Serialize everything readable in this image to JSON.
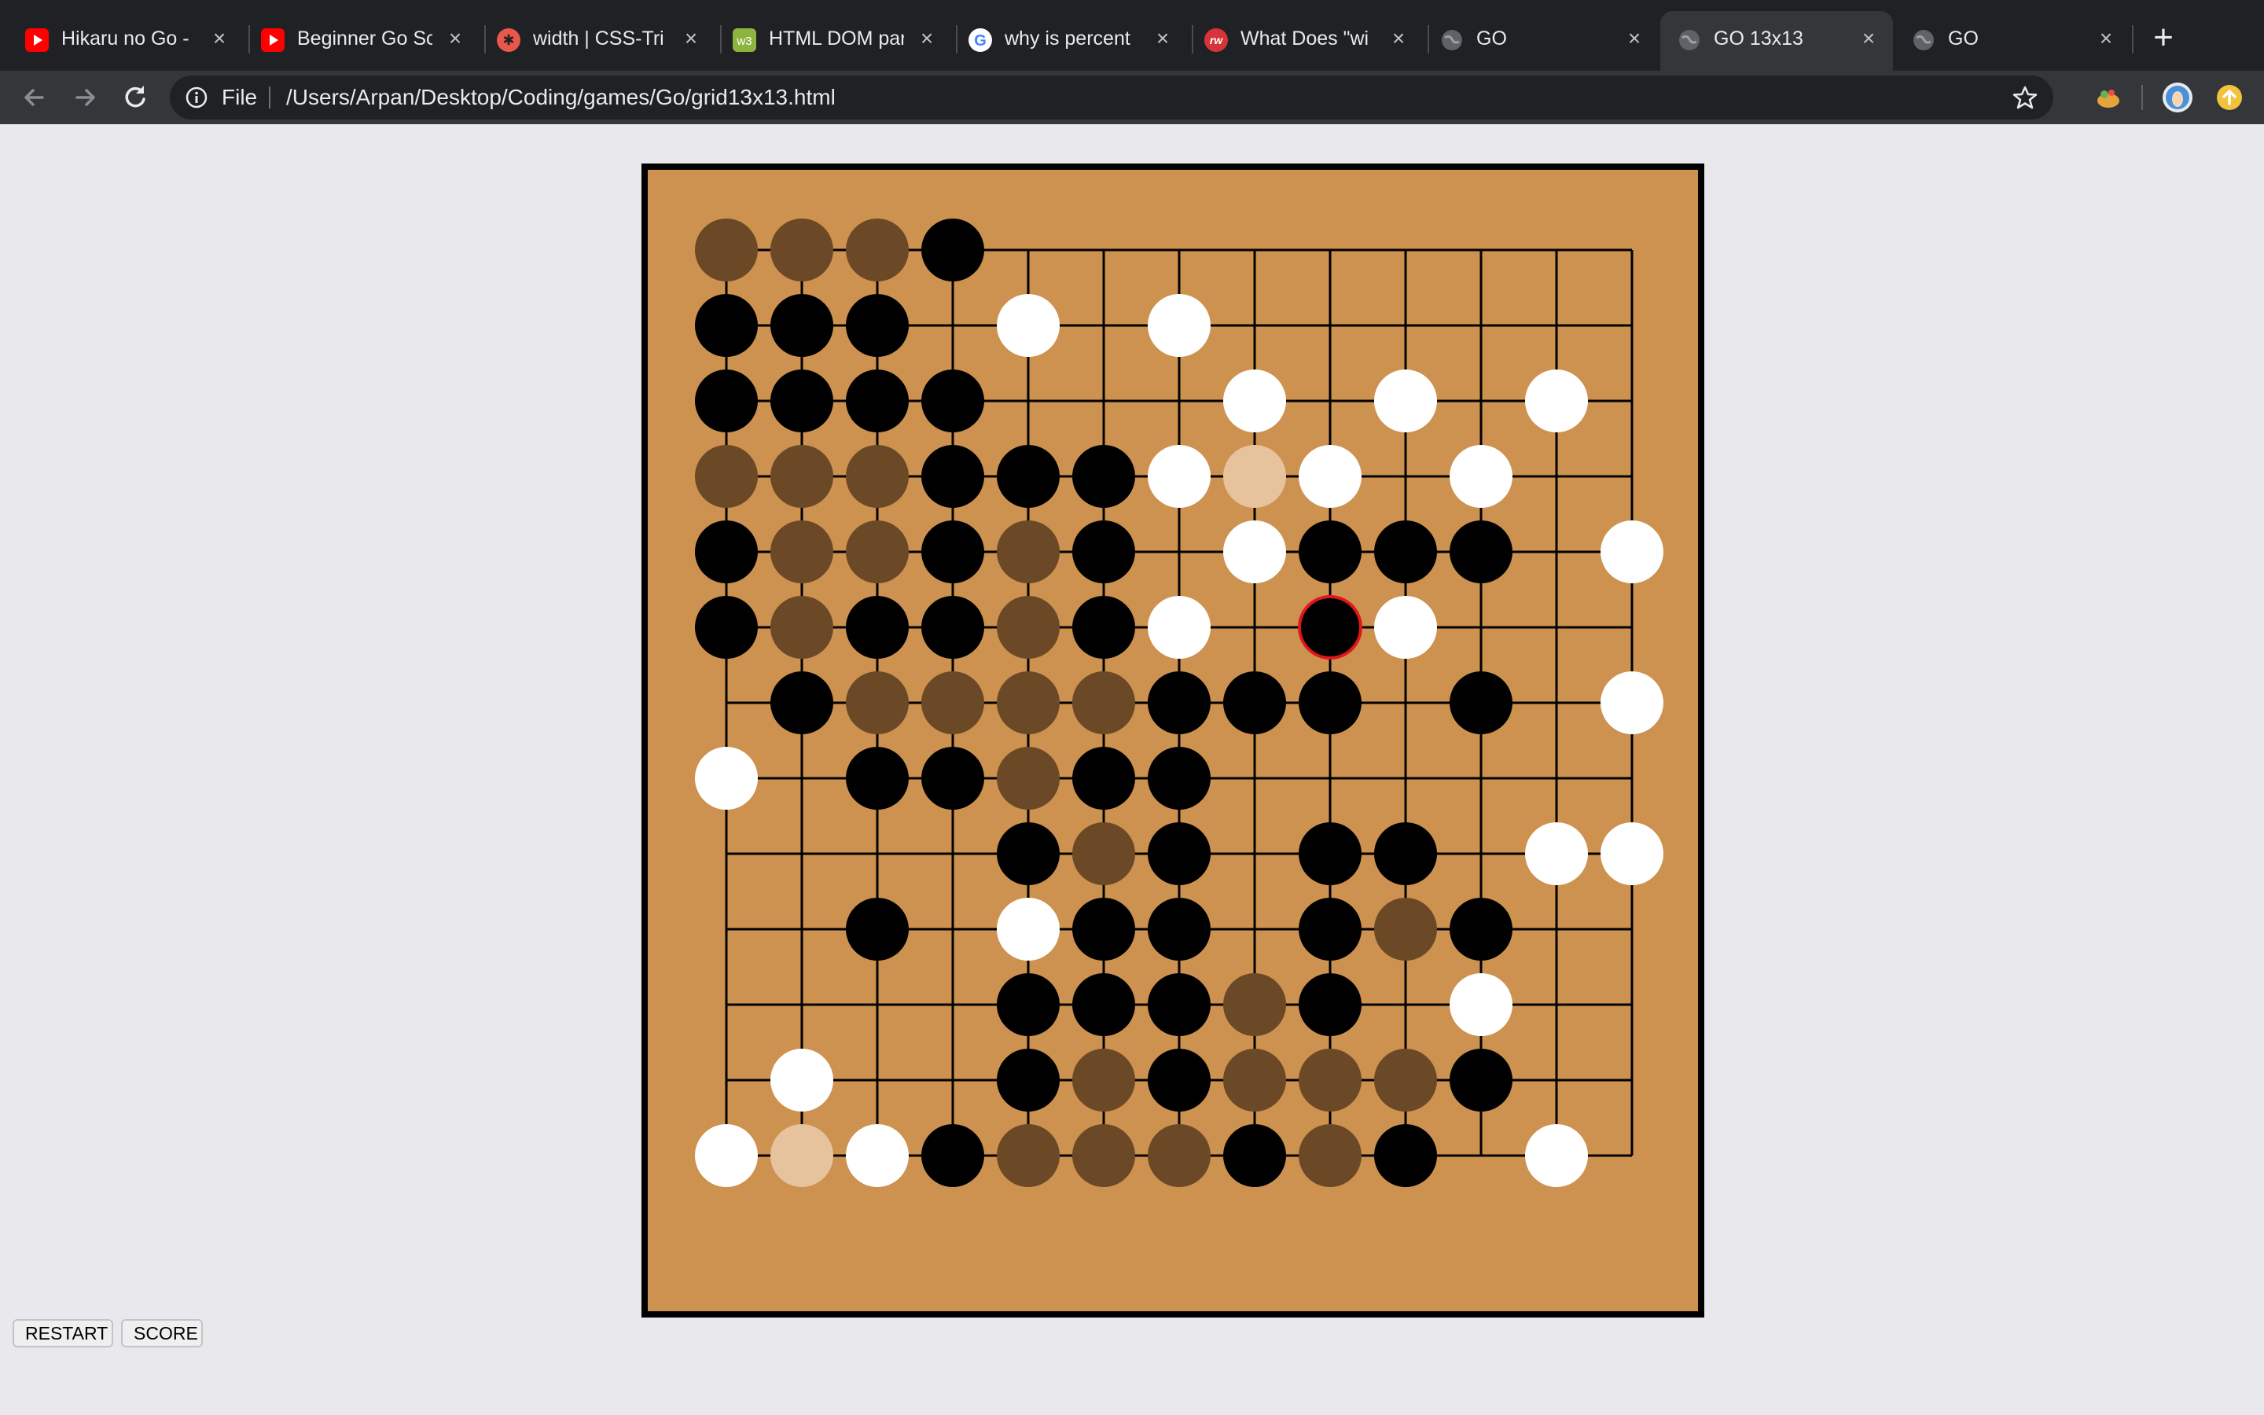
{
  "browser": {
    "tabs": [
      {
        "title": "Hikaru no Go -",
        "favicon": "youtube-icon"
      },
      {
        "title": "Beginner Go Sc",
        "favicon": "youtube-icon"
      },
      {
        "title": "width | CSS-Tri",
        "favicon": "css-tricks-icon"
      },
      {
        "title": "HTML DOM par",
        "favicon": "w3schools-icon"
      },
      {
        "title": "why is percent",
        "favicon": "google-icon"
      },
      {
        "title": "What Does \"wi",
        "favicon": "raywenderlich-icon"
      },
      {
        "title": "GO",
        "favicon": "globe-icon"
      },
      {
        "title": "GO 13x13",
        "favicon": "globe-icon",
        "active": true
      },
      {
        "title": "GO",
        "favicon": "globe-icon"
      }
    ],
    "address": {
      "scheme": "File",
      "url": "/Users/Arpan/Desktop/Coding/games/Go/grid13x13.html"
    }
  },
  "colors": {
    "board": "#cd9150",
    "line": "#000000",
    "black_stone": "#000000",
    "white_stone": "#ffffff",
    "dead_black": "#6b4826",
    "dead_white": "#e6c39c",
    "last_move_ring": "#e0161c"
  },
  "game": {
    "board_size": 13,
    "legend": "B = black stone, W = white stone, b = faded black (marked dead), w = faded white (marked dead), R = last move (black, red ring), . = empty",
    "rows": [
      "bbbB.........",
      "BBB.W.W......",
      "BBBB...W.W.W.",
      "bbbBBBWwW.W..",
      "BbbBbB.WBBB.W",
      "BbBBbBW.RW...",
      ".BbbbbBBB.B.W",
      "W.BBbBB......",
      "....BbB.BB.WW",
      "..B.WBB.BbB..",
      "....BBBbB.W..",
      ".W..BbBbbbB..",
      "WwWBbbbBbB.W."
    ]
  },
  "controls": {
    "restart_label": "RESTART",
    "score_label": "SCORE"
  }
}
